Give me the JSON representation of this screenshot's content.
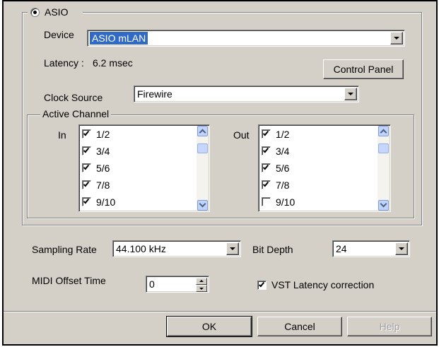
{
  "asio": {
    "label": "ASIO",
    "selected": true,
    "device_label": "Device",
    "device_value": "ASIO mLAN",
    "latency_label": "Latency :",
    "latency_value": "6.2 msec",
    "control_panel_label": "Control Panel",
    "clock_source_label": "Clock Source",
    "clock_source_value": "Firewire"
  },
  "active_channel": {
    "label": "Active Channel",
    "in_label": "In",
    "out_label": "Out",
    "in_channels": [
      {
        "label": "1/2",
        "checked": true
      },
      {
        "label": "3/4",
        "checked": true
      },
      {
        "label": "5/6",
        "checked": true
      },
      {
        "label": "7/8",
        "checked": true
      },
      {
        "label": "9/10",
        "checked": true
      }
    ],
    "out_channels": [
      {
        "label": "1/2",
        "checked": true
      },
      {
        "label": "3/4",
        "checked": true
      },
      {
        "label": "5/6",
        "checked": true
      },
      {
        "label": "7/8",
        "checked": true
      },
      {
        "label": "9/10",
        "checked": false
      }
    ]
  },
  "settings": {
    "sampling_rate_label": "Sampling Rate",
    "sampling_rate_value": "44.100 kHz",
    "bit_depth_label": "Bit Depth",
    "bit_depth_value": "24",
    "midi_offset_label": "MIDI Offset Time",
    "midi_offset_value": "0",
    "vst_latency_label": "VST Latency correction",
    "vst_latency_checked": true
  },
  "buttons": {
    "ok": "OK",
    "cancel": "Cancel",
    "help": "Help"
  },
  "colors": {
    "dialog_bg": "#d4d0c8",
    "selection": "#316ac5"
  },
  "icons": {
    "dropdown": "chevron-down-icon",
    "scroll_up": "scroll-up-icon",
    "scroll_down": "scroll-down-icon",
    "check": "checkmark-icon",
    "radio": "radio-dot-icon"
  }
}
